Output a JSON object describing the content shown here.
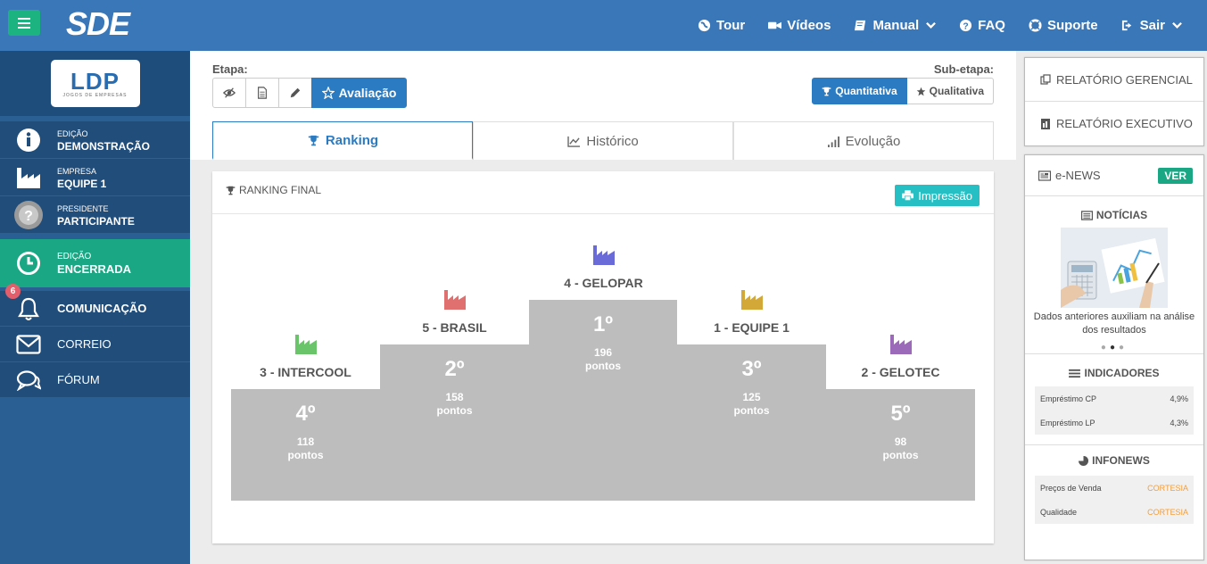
{
  "topbar": {
    "brand": "SDE",
    "nav": [
      {
        "label": "Tour",
        "icon": "globe-icon"
      },
      {
        "label": "Vídeos",
        "icon": "video-icon"
      },
      {
        "label": "Manual",
        "icon": "book-icon"
      },
      {
        "label": "FAQ",
        "icon": "question-icon"
      },
      {
        "label": "Suporte",
        "icon": "lifebuoy-icon"
      },
      {
        "label": "Sair",
        "icon": "signout-icon"
      }
    ]
  },
  "sidebar": {
    "logo_text": "LDP",
    "logo_sub": "JOGOS DE EMPRESAS",
    "items": [
      {
        "small": "EDIÇÃO",
        "big": "DEMONSTRAÇÃO"
      },
      {
        "small": "EMPRESA",
        "big": "EQUIPE 1"
      },
      {
        "small": "PRESIDENTE",
        "big": "PARTICIPANTE"
      }
    ],
    "status": {
      "small": "EDIÇÃO",
      "big": "ENCERRADA"
    },
    "comunicacao": {
      "label": "COMUNICAÇÃO",
      "badge": "6"
    },
    "correio": "CORREIO",
    "forum": "FÓRUM"
  },
  "main": {
    "etapa_label": "Etapa:",
    "etapa_active": "Avaliação",
    "subetapa_label": "Sub-etapa:",
    "sub_active": "Quantitativa",
    "sub_other": "Qualitativa",
    "tabs": [
      "Ranking",
      "Histórico",
      "Evolução"
    ],
    "panel_title": "RANKING FINAL",
    "print_label": "Impressão",
    "points_unit": "pontos",
    "podium": [
      {
        "team": "3 - INTERCOOL",
        "pos": "4º",
        "points": "118",
        "color": "#6ac46a"
      },
      {
        "team": "5 - BRASIL",
        "pos": "2º",
        "points": "158",
        "color": "#e07070"
      },
      {
        "team": "4 - GELOPAR",
        "pos": "1º",
        "points": "196",
        "color": "#6a6ad8"
      },
      {
        "team": "1 - EQUIPE 1",
        "pos": "3º",
        "points": "125",
        "color": "#d4a838"
      },
      {
        "team": "2 - GELOTEC",
        "pos": "5º",
        "points": "98",
        "color": "#9b6ab8"
      }
    ]
  },
  "right": {
    "rel_gerencial": "RELATÓRIO GERENCIAL",
    "rel_executivo": "RELATÓRIO EXECUTIVO",
    "enews": "e-NEWS",
    "ver": "VER",
    "noticias": "NOTÍCIAS",
    "news_caption": "Dados anteriores auxiliam na análise dos resultados",
    "indicadores": "INDICADORES",
    "ind_rows": [
      {
        "label": "Empréstimo CP",
        "value": "4,9%"
      },
      {
        "label": "Empréstimo LP",
        "value": "4,3%"
      }
    ],
    "infonews": "INFONEWS",
    "info_rows": [
      {
        "label": "Preços de Venda",
        "value": "CORTESIA"
      },
      {
        "label": "Qualidade",
        "value": "CORTESIA"
      }
    ]
  }
}
